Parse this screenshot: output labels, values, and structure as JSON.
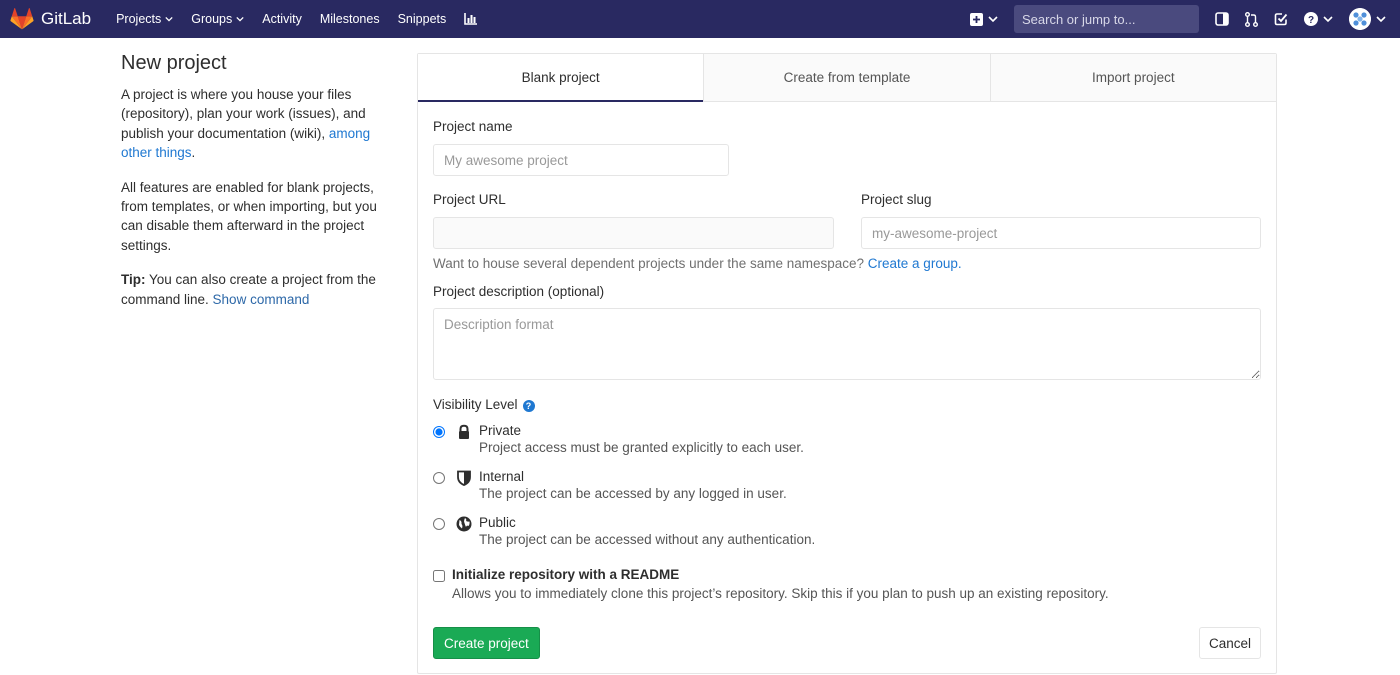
{
  "navbar": {
    "brand": "GitLab",
    "links": [
      {
        "label": "Projects",
        "dropdown": true
      },
      {
        "label": "Groups",
        "dropdown": true
      },
      {
        "label": "Activity",
        "dropdown": false
      },
      {
        "label": "Milestones",
        "dropdown": false
      },
      {
        "label": "Snippets",
        "dropdown": false
      }
    ],
    "search_placeholder": "Search or jump to...",
    "icons": [
      "chart-icon",
      "plus-square-icon",
      "sidebar-toggle-icon",
      "merge-request-icon",
      "todo-check-icon",
      "help-circle-icon",
      "user-avatar"
    ]
  },
  "intro": {
    "title": "New project",
    "p1": "A project is where you house your files (repository), plan your work (issues), and publish your documentation (wiki), ",
    "p1_link": "among other things",
    "p1_end": ".",
    "p2": "All features are enabled for blank projects, from templates, or when importing, but you can disable them afterward in the project settings.",
    "tip_label": "Tip:",
    "tip_text": " You can also create a project from the command line. ",
    "tip_link": "Show command"
  },
  "tabs": [
    {
      "label": "Blank project",
      "active": true
    },
    {
      "label": "Create from template",
      "active": false
    },
    {
      "label": "Import project",
      "active": false
    }
  ],
  "form": {
    "project_name_label": "Project name",
    "project_name_placeholder": "My awesome project",
    "project_url_label": "Project URL",
    "project_url_value": "",
    "project_slug_label": "Project slug",
    "project_slug_placeholder": "my-awesome-project",
    "namespace_help": "Want to house several dependent projects under the same namespace? ",
    "namespace_link": "Create a group.",
    "description_label": "Project description (optional)",
    "description_placeholder": "Description format",
    "visibility_label": "Visibility Level",
    "visibility_options": [
      {
        "title": "Private",
        "desc": "Project access must be granted explicitly to each user.",
        "icon": "lock-icon",
        "checked": true
      },
      {
        "title": "Internal",
        "desc": "The project can be accessed by any logged in user.",
        "icon": "shield-icon",
        "checked": false
      },
      {
        "title": "Public",
        "desc": "The project can be accessed without any authentication.",
        "icon": "globe-icon",
        "checked": false
      }
    ],
    "readme_title": "Initialize repository with a README",
    "readme_desc": "Allows you to immediately clone this project’s repository. Skip this if you plan to push up an existing repository.",
    "create_button": "Create project",
    "cancel_button": "Cancel"
  },
  "colors": {
    "navbar": "#292961",
    "link": "#1f78d1",
    "success": "#1aaa55"
  }
}
